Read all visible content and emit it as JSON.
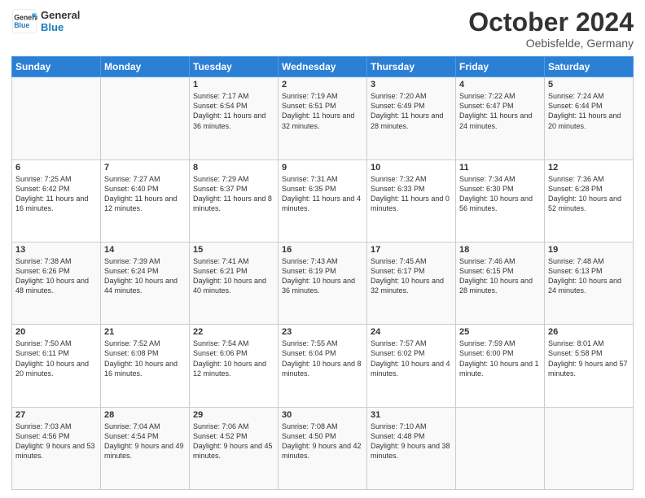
{
  "header": {
    "logo": {
      "line1": "General",
      "line2": "Blue"
    },
    "title": "October 2024",
    "location": "Oebisfelde, Germany"
  },
  "weekdays": [
    "Sunday",
    "Monday",
    "Tuesday",
    "Wednesday",
    "Thursday",
    "Friday",
    "Saturday"
  ],
  "weeks": [
    [
      {
        "day": "",
        "info": ""
      },
      {
        "day": "",
        "info": ""
      },
      {
        "day": "1",
        "info": "Sunrise: 7:17 AM\nSunset: 6:54 PM\nDaylight: 11 hours and 36 minutes."
      },
      {
        "day": "2",
        "info": "Sunrise: 7:19 AM\nSunset: 6:51 PM\nDaylight: 11 hours and 32 minutes."
      },
      {
        "day": "3",
        "info": "Sunrise: 7:20 AM\nSunset: 6:49 PM\nDaylight: 11 hours and 28 minutes."
      },
      {
        "day": "4",
        "info": "Sunrise: 7:22 AM\nSunset: 6:47 PM\nDaylight: 11 hours and 24 minutes."
      },
      {
        "day": "5",
        "info": "Sunrise: 7:24 AM\nSunset: 6:44 PM\nDaylight: 11 hours and 20 minutes."
      }
    ],
    [
      {
        "day": "6",
        "info": "Sunrise: 7:25 AM\nSunset: 6:42 PM\nDaylight: 11 hours and 16 minutes."
      },
      {
        "day": "7",
        "info": "Sunrise: 7:27 AM\nSunset: 6:40 PM\nDaylight: 11 hours and 12 minutes."
      },
      {
        "day": "8",
        "info": "Sunrise: 7:29 AM\nSunset: 6:37 PM\nDaylight: 11 hours and 8 minutes."
      },
      {
        "day": "9",
        "info": "Sunrise: 7:31 AM\nSunset: 6:35 PM\nDaylight: 11 hours and 4 minutes."
      },
      {
        "day": "10",
        "info": "Sunrise: 7:32 AM\nSunset: 6:33 PM\nDaylight: 11 hours and 0 minutes."
      },
      {
        "day": "11",
        "info": "Sunrise: 7:34 AM\nSunset: 6:30 PM\nDaylight: 10 hours and 56 minutes."
      },
      {
        "day": "12",
        "info": "Sunrise: 7:36 AM\nSunset: 6:28 PM\nDaylight: 10 hours and 52 minutes."
      }
    ],
    [
      {
        "day": "13",
        "info": "Sunrise: 7:38 AM\nSunset: 6:26 PM\nDaylight: 10 hours and 48 minutes."
      },
      {
        "day": "14",
        "info": "Sunrise: 7:39 AM\nSunset: 6:24 PM\nDaylight: 10 hours and 44 minutes."
      },
      {
        "day": "15",
        "info": "Sunrise: 7:41 AM\nSunset: 6:21 PM\nDaylight: 10 hours and 40 minutes."
      },
      {
        "day": "16",
        "info": "Sunrise: 7:43 AM\nSunset: 6:19 PM\nDaylight: 10 hours and 36 minutes."
      },
      {
        "day": "17",
        "info": "Sunrise: 7:45 AM\nSunset: 6:17 PM\nDaylight: 10 hours and 32 minutes."
      },
      {
        "day": "18",
        "info": "Sunrise: 7:46 AM\nSunset: 6:15 PM\nDaylight: 10 hours and 28 minutes."
      },
      {
        "day": "19",
        "info": "Sunrise: 7:48 AM\nSunset: 6:13 PM\nDaylight: 10 hours and 24 minutes."
      }
    ],
    [
      {
        "day": "20",
        "info": "Sunrise: 7:50 AM\nSunset: 6:11 PM\nDaylight: 10 hours and 20 minutes."
      },
      {
        "day": "21",
        "info": "Sunrise: 7:52 AM\nSunset: 6:08 PM\nDaylight: 10 hours and 16 minutes."
      },
      {
        "day": "22",
        "info": "Sunrise: 7:54 AM\nSunset: 6:06 PM\nDaylight: 10 hours and 12 minutes."
      },
      {
        "day": "23",
        "info": "Sunrise: 7:55 AM\nSunset: 6:04 PM\nDaylight: 10 hours and 8 minutes."
      },
      {
        "day": "24",
        "info": "Sunrise: 7:57 AM\nSunset: 6:02 PM\nDaylight: 10 hours and 4 minutes."
      },
      {
        "day": "25",
        "info": "Sunrise: 7:59 AM\nSunset: 6:00 PM\nDaylight: 10 hours and 1 minute."
      },
      {
        "day": "26",
        "info": "Sunrise: 8:01 AM\nSunset: 5:58 PM\nDaylight: 9 hours and 57 minutes."
      }
    ],
    [
      {
        "day": "27",
        "info": "Sunrise: 7:03 AM\nSunset: 4:56 PM\nDaylight: 9 hours and 53 minutes."
      },
      {
        "day": "28",
        "info": "Sunrise: 7:04 AM\nSunset: 4:54 PM\nDaylight: 9 hours and 49 minutes."
      },
      {
        "day": "29",
        "info": "Sunrise: 7:06 AM\nSunset: 4:52 PM\nDaylight: 9 hours and 45 minutes."
      },
      {
        "day": "30",
        "info": "Sunrise: 7:08 AM\nSunset: 4:50 PM\nDaylight: 9 hours and 42 minutes."
      },
      {
        "day": "31",
        "info": "Sunrise: 7:10 AM\nSunset: 4:48 PM\nDaylight: 9 hours and 38 minutes."
      },
      {
        "day": "",
        "info": ""
      },
      {
        "day": "",
        "info": ""
      }
    ]
  ]
}
